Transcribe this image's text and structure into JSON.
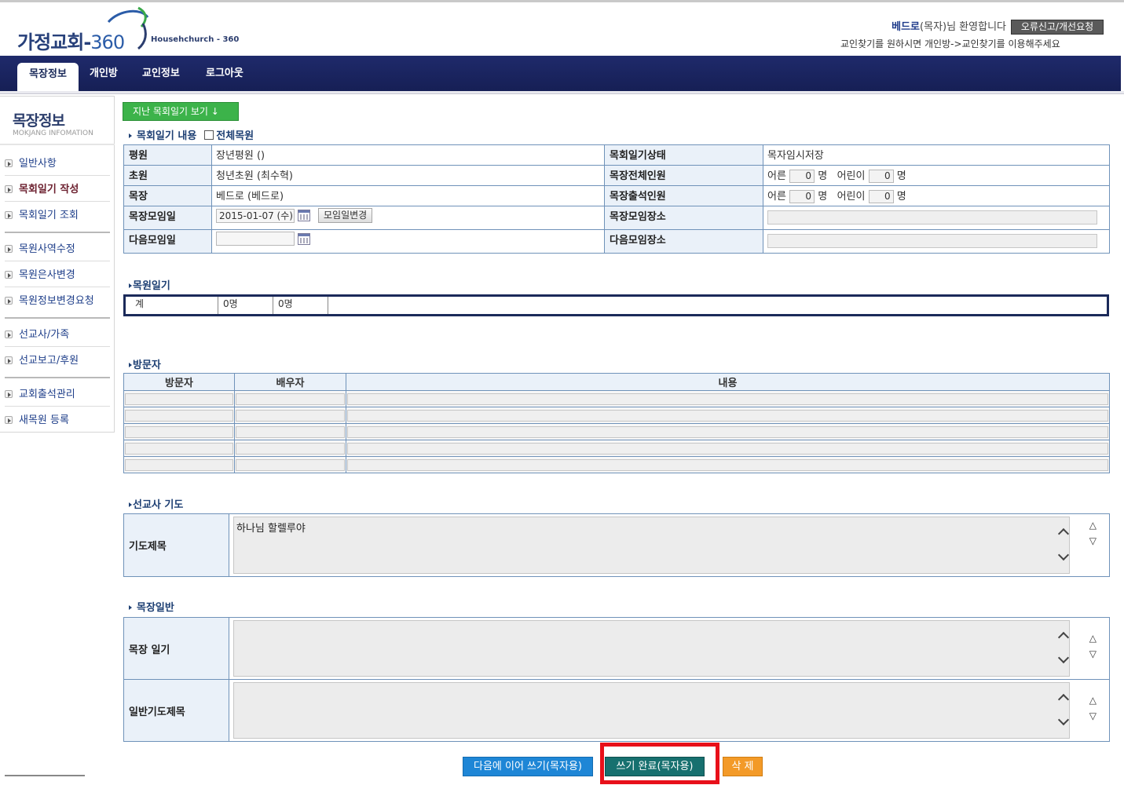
{
  "header": {
    "logo_main": "가정교회-",
    "logo_num": "360",
    "logo_sub": "Househchurch - 360",
    "welcome_user": "베드로",
    "welcome_rest": "(목자)님 환영합니다",
    "report_button": "오류신고/개선요청",
    "note": "교인찾기를 원하시면 개인방->교인찾기를 이용해주세요"
  },
  "nav": {
    "tabs": [
      {
        "label": "목장정보",
        "active": true
      },
      {
        "label": "개인방"
      },
      {
        "label": "교인정보"
      },
      {
        "label": "로그아웃"
      }
    ]
  },
  "sidebar": {
    "title": "목장정보",
    "subtitle": "MOKJANG INFOMATION",
    "items": [
      {
        "label": "일반사항"
      },
      {
        "label": "목회일기 작성",
        "current": true
      },
      {
        "label": "목회일기 조회"
      },
      {
        "label": "목원사역수정"
      },
      {
        "label": "목원은사변경"
      },
      {
        "label": "목원정보변경요청"
      },
      {
        "label": "선교사/가족"
      },
      {
        "label": "선교보고/후원"
      },
      {
        "label": "교회출석관리"
      },
      {
        "label": "새목원 등록"
      }
    ]
  },
  "main": {
    "past_diary_button": "지난 목회일기 보기 ↓",
    "content_section": "목회일기 내용",
    "all_members_label": "전체목원",
    "info": {
      "r1_label_a": "평원",
      "r1_val_a": "장년평원 ()",
      "r1_label_b": "목회일기상태",
      "r1_val_b": "목자임시저장",
      "r2_label_a": "초원",
      "r2_val_a": "청년초원 (최수혁)",
      "r2_label_b": "목장전체인원",
      "r3_label_a": "목장",
      "r3_val_a": "베드로 (베드로)",
      "r3_label_b": "목장출석인원",
      "r4_label_a": "목장모임일",
      "r4_date": "2015-01-07 (수)",
      "r4_change_button": "모임일변경",
      "r4_label_b": "목장모임장소",
      "r5_label_a": "다음모임일",
      "r5_label_b": "다음모임장소",
      "adult_label": "어른",
      "child_label": "어린이",
      "unit": "명",
      "total_adults": "0",
      "total_children": "0",
      "attend_adults": "0",
      "attend_children": "0"
    },
    "member_section": "목원일기",
    "member_row": {
      "c1": "계",
      "c2": "0명",
      "c3": "0명"
    },
    "visitor_section": "방문자",
    "visitor_headers": {
      "visitor": "방문자",
      "spouse": "배우자",
      "content": "내용"
    },
    "missionary_section": "선교사 기도",
    "prayer_title_label": "기도제목",
    "prayer_title_value": "하나님 할렐루야",
    "general_section": "목장일반",
    "mokjang_diary_label": "목장 일기",
    "general_prayer_label": "일반기도제목",
    "size_up": "△",
    "size_down": "▽"
  },
  "actions": {
    "continue_later": "다음에 이어 쓰기(목자용)",
    "complete": "쓰기 완료(목자용)",
    "delete": "삭 제"
  },
  "colors": {
    "nav_bg": "#1f2a6b",
    "label_bg": "#eaf1f9",
    "border": "#6f92b9",
    "green": "#3cb34a",
    "blue": "#1e86d6",
    "teal": "#17706f",
    "orange": "#f39a28",
    "highlight": "#e8101a"
  }
}
